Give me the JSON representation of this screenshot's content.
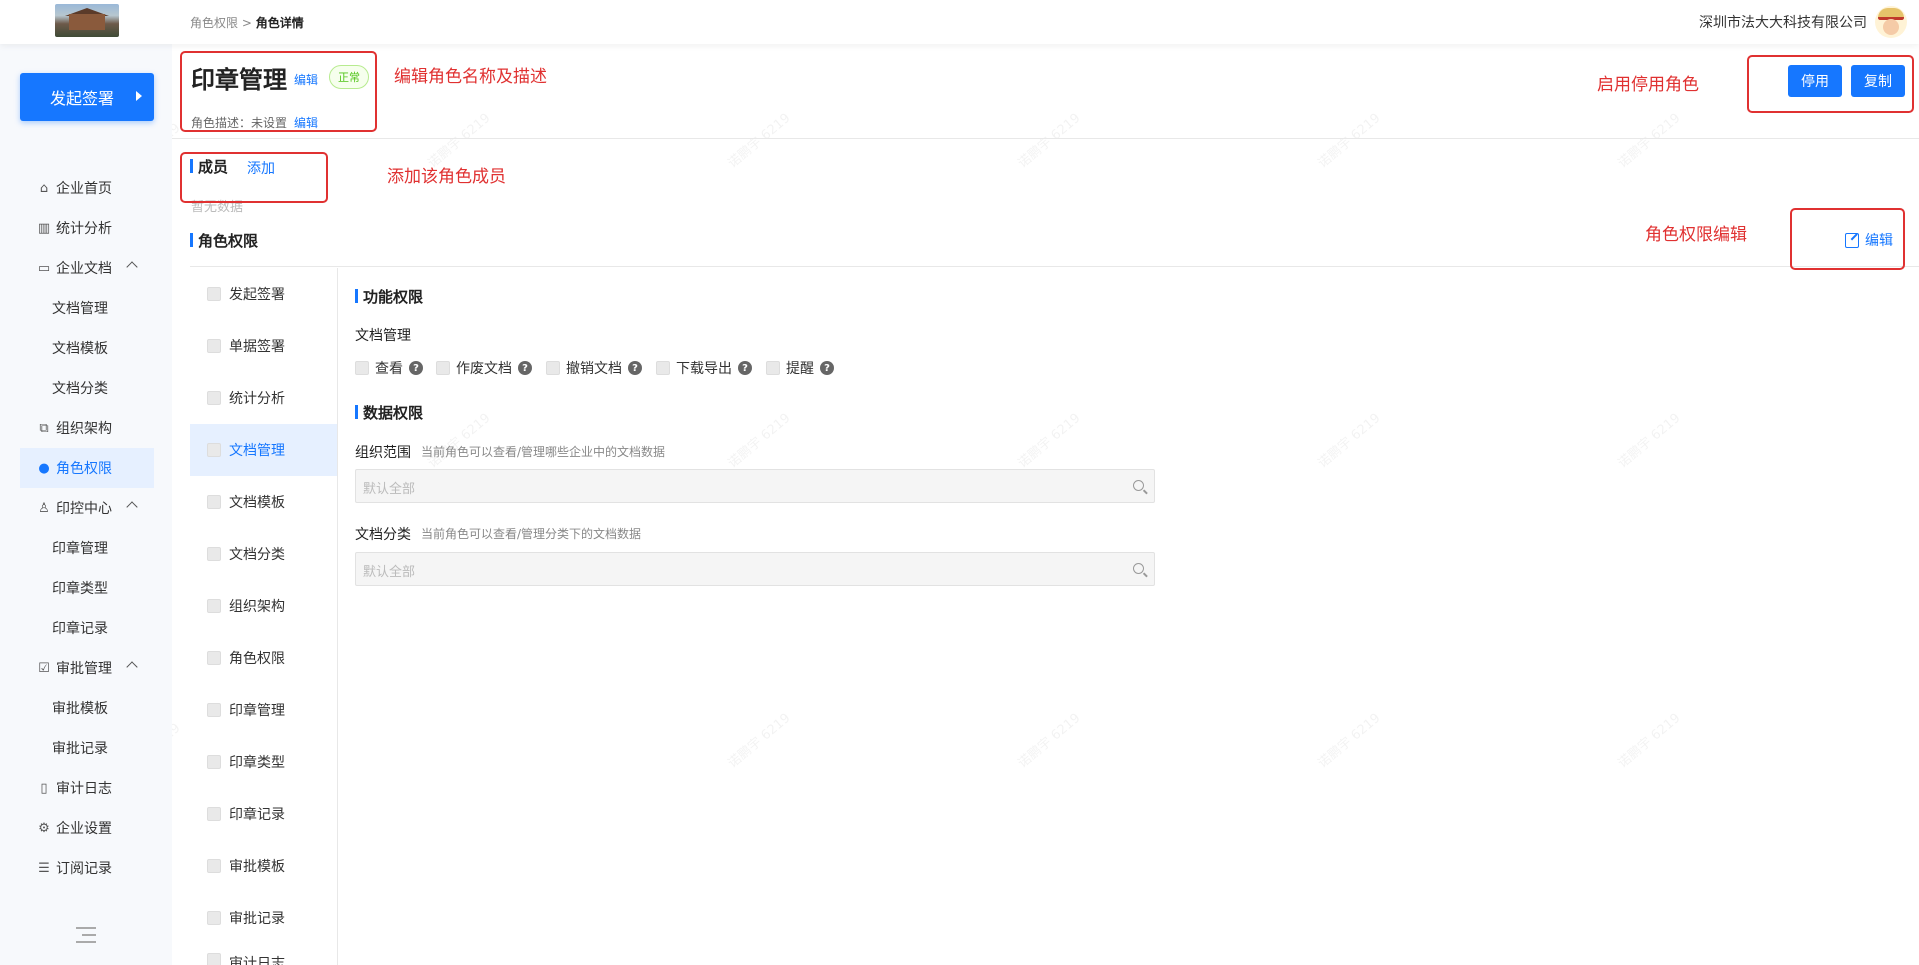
{
  "header": {
    "breadcrumb_parent": "角色权限",
    "breadcrumb_sep": " > ",
    "breadcrumb_current": "角色详情",
    "company": "深圳市法大大科技有限公司"
  },
  "sidebar": {
    "launch_label": "发起签署",
    "items": [
      {
        "label": "企业首页",
        "icon": "home-icon"
      },
      {
        "label": "统计分析",
        "icon": "chart-icon"
      },
      {
        "label": "企业文档",
        "icon": "folder-icon"
      },
      {
        "label": "文档管理"
      },
      {
        "label": "文档模板"
      },
      {
        "label": "文档分类"
      },
      {
        "label": "组织架构",
        "icon": "org-icon"
      },
      {
        "label": "角色权限",
        "icon": "role-icon"
      },
      {
        "label": "印控中心",
        "icon": "seal-icon"
      },
      {
        "label": "印章管理"
      },
      {
        "label": "印章类型"
      },
      {
        "label": "印章记录"
      },
      {
        "label": "审批管理",
        "icon": "approval-icon"
      },
      {
        "label": "审批模板"
      },
      {
        "label": "审批记录"
      },
      {
        "label": "审计日志",
        "icon": "log-icon"
      },
      {
        "label": "企业设置",
        "icon": "settings-icon"
      },
      {
        "label": "订阅记录",
        "icon": "list-icon"
      }
    ]
  },
  "role": {
    "name": "印章管理",
    "edit": "编辑",
    "status": "正常",
    "desc_label": "角色描述：未设置",
    "desc_edit": "编辑",
    "disable_btn": "停用",
    "copy_btn": "复制"
  },
  "members": {
    "title": "成员",
    "add": "添加",
    "empty": "暂无数据"
  },
  "permissions": {
    "title": "角色权限",
    "edit": "编辑",
    "modules": [
      "发起签署",
      "单据签署",
      "统计分析",
      "文档管理",
      "文档模板",
      "文档分类",
      "组织架构",
      "角色权限",
      "印章管理",
      "印章类型",
      "印章记录",
      "审批模板",
      "审批记录",
      "审计日志"
    ],
    "active_module": "文档管理",
    "func_title": "功能权限",
    "func_group": "文档管理",
    "func_items": [
      "查看",
      "作废文档",
      "撤销文档",
      "下载导出",
      "提醒"
    ],
    "data_title": "数据权限",
    "org_label": "组织范围",
    "org_hint": "当前角色可以查看/管理哪些企业中的文档数据",
    "org_placeholder": "默认全部",
    "cat_label": "文档分类",
    "cat_hint": "当前角色可以查看/管理分类下的文档数据",
    "cat_placeholder": "默认全部"
  },
  "annotations": {
    "name_desc": "编辑角色名称及描述",
    "members": "添加该角色成员",
    "toggle": "启用停用角色",
    "perm_edit": "角色权限编辑"
  },
  "watermark": "诺鹏宇 6219",
  "colors": {
    "accent": "#1677ff",
    "annotation": "#e03131",
    "status": "#52c41a"
  }
}
